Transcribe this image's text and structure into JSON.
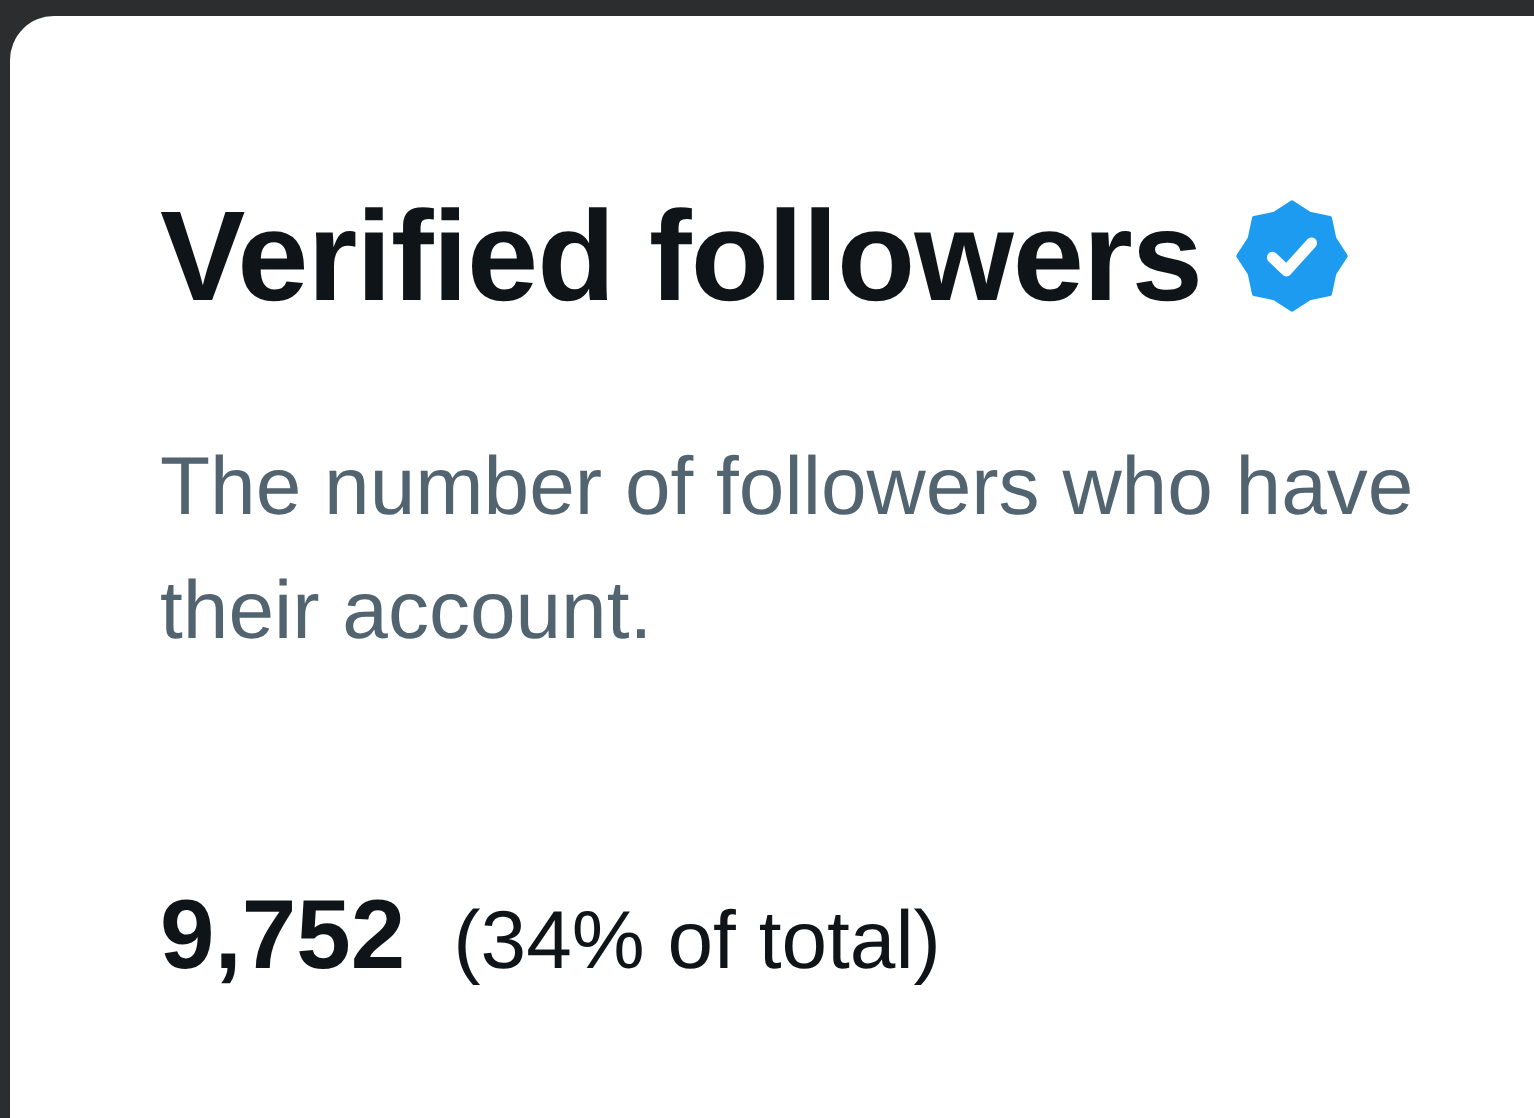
{
  "card": {
    "title": "Verified followers",
    "description_lines": [
      "The number of followers who have",
      "their account."
    ],
    "count": "9,752",
    "share": "(34% of total)"
  }
}
